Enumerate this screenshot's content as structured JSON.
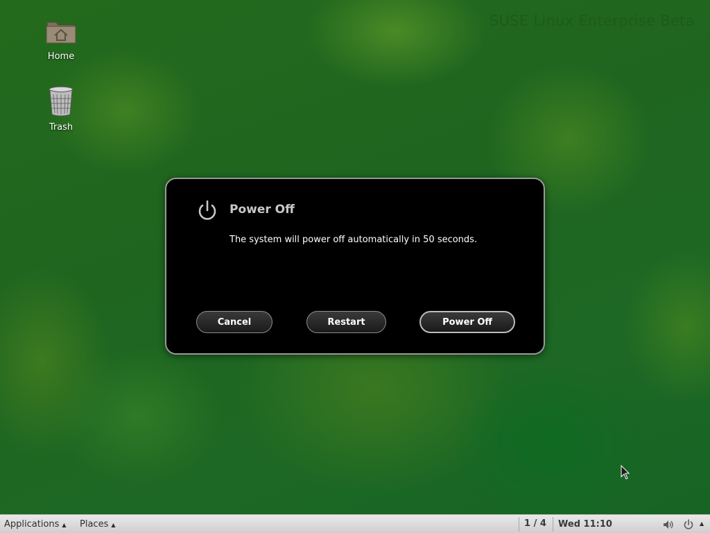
{
  "desktop": {
    "watermark": "SUSE Linux Enterprise Beta",
    "icons": [
      {
        "label": "Home",
        "icon": "home-folder-icon"
      },
      {
        "label": "Trash",
        "icon": "trash-icon"
      }
    ]
  },
  "dialog": {
    "title": "Power Off",
    "icon": "power-icon",
    "message": "The system will power off automatically in 50 seconds.",
    "buttons": {
      "cancel": "Cancel",
      "restart": "Restart",
      "power_off": "Power Off"
    }
  },
  "panel": {
    "applications": "Applications",
    "places": "Places",
    "workspace": "1 / 4",
    "clock": "Wed 11:10",
    "tray_icons": [
      "volume-icon",
      "power-icon",
      "arrow-up-icon"
    ]
  },
  "colors": {
    "desktop_bg": "#1f6520",
    "dialog_bg": "#000000",
    "panel_bg": "#dcdcdc"
  }
}
